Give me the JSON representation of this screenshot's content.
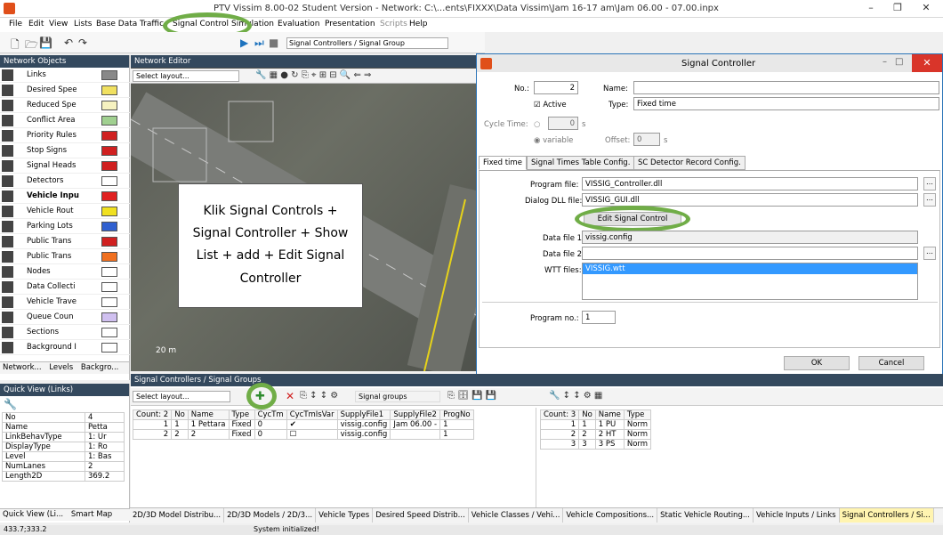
{
  "window": {
    "title": "PTV Vissim 8.00-02 Student Version - Network: C:\\...ents\\FIXXX\\Data Vissim\\Jam 16-17 am\\Jam 06.00 - 07.00.inpx",
    "controls": [
      "–",
      "❐",
      "✕"
    ]
  },
  "menu": [
    "File",
    "Edit",
    "View",
    "Lists",
    "Base Data",
    "Traffic",
    "Signal Control",
    "Simulation",
    "Evaluation",
    "Presentation",
    "Scripts",
    "Help"
  ],
  "toolbar": {
    "list_combo": "Signal Controllers / Signal Group"
  },
  "network_objects": {
    "title": "Network Objects",
    "items": [
      {
        "label": "Links",
        "icon": "link-icon"
      },
      {
        "label": "Desired Spee",
        "icon": "desired-speed-icon"
      },
      {
        "label": "Reduced Spe",
        "icon": "reduced-speed-icon"
      },
      {
        "label": "Conflict Area",
        "icon": "conflict-area-icon"
      },
      {
        "label": "Priority Rules",
        "icon": "priority-rule-icon"
      },
      {
        "label": "Stop Signs",
        "icon": "stop-sign-icon"
      },
      {
        "label": "Signal Heads",
        "icon": "signal-head-icon"
      },
      {
        "label": "Detectors",
        "icon": "detector-icon"
      },
      {
        "label": "Vehicle Inpu",
        "icon": "vehicle-input-icon"
      },
      {
        "label": "Vehicle Rout",
        "icon": "vehicle-route-icon"
      },
      {
        "label": "Parking Lots",
        "icon": "parking-icon"
      },
      {
        "label": "Public Trans",
        "icon": "public-transport-stop-icon"
      },
      {
        "label": "Public Trans",
        "icon": "public-transport-line-icon"
      },
      {
        "label": "Nodes",
        "icon": "node-icon"
      },
      {
        "label": "Data Collecti",
        "icon": "data-collection-icon"
      },
      {
        "label": "Vehicle Trave",
        "icon": "travel-time-icon"
      },
      {
        "label": "Queue Coun",
        "icon": "queue-counter-icon"
      },
      {
        "label": "Sections",
        "icon": "section-icon"
      },
      {
        "label": "Background I",
        "icon": "background-image-icon"
      }
    ],
    "tabs": [
      "Network...",
      "Levels",
      "Backgro..."
    ]
  },
  "network_editor": {
    "title": "Network Editor",
    "layout_combo": "Select layout...",
    "scale": "20 m"
  },
  "callout": {
    "text": "Klik Signal Controls + Signal Controller + Show List + add + Edit Signal Controller"
  },
  "quick_view": {
    "title": "Quick View (Links)",
    "rows": [
      [
        "No",
        "4"
      ],
      [
        "Name",
        "Petta"
      ],
      [
        "LinkBehavType",
        "1: Ur"
      ],
      [
        "DisplayType",
        "1: Ro"
      ],
      [
        "Level",
        "1: Bas"
      ],
      [
        "NumLanes",
        "2"
      ],
      [
        "Length2D",
        "369.2"
      ]
    ],
    "tabs": [
      "Quick View (Li...",
      "Smart Map"
    ]
  },
  "sc_list": {
    "title": "Signal Controllers / Signal Groups",
    "layout_combo": "Select layout...",
    "relation_combo": "Signal groups",
    "count_label": "Count: 2",
    "columns": [
      "No",
      "Name",
      "Type",
      "CycTm",
      "CycTmIsVar",
      "SupplyFile1",
      "SupplyFile2",
      "ProgNo"
    ],
    "rows": [
      [
        "1",
        "1 Pettara",
        "Fixed",
        "0",
        "✔",
        "vissig.config",
        "Jam 06.00 -",
        "1"
      ],
      [
        "2",
        "2",
        "Fixed",
        "0",
        "☐",
        "vissig.config",
        "",
        "1"
      ]
    ]
  },
  "sg_list": {
    "count_label": "Count: 3",
    "columns": [
      "No",
      "Name",
      "Type"
    ],
    "rows": [
      [
        "1",
        "1 PU",
        "Norm"
      ],
      [
        "2",
        "2 HT",
        "Norm"
      ],
      [
        "3",
        "3 PS",
        "Norm"
      ]
    ]
  },
  "dialog": {
    "title": "Signal Controller",
    "no_label": "No.:",
    "no_value": "2",
    "name_label": "Name:",
    "name_value": "",
    "active_label": "Active",
    "type_label": "Type:",
    "type_value": "Fixed time",
    "cycle_label": "Cycle Time:",
    "cycle_value": "0",
    "cycle_unit": "s",
    "variable_label": "variable",
    "offset_label": "Offset:",
    "offset_value": "0",
    "offset_unit": "s",
    "tabs": [
      "Fixed time",
      "Signal Times Table Config.",
      "SC Detector Record Config."
    ],
    "program_file_label": "Program file:",
    "program_file": "VISSIG_Controller.dll",
    "dialog_dll_label": "Dialog DLL file:",
    "dialog_dll": "VISSIG_GUI.dll",
    "edit_button": "Edit Signal Control",
    "data1_label": "Data file 1:",
    "data1": "vissig.config",
    "data2_label": "Data file 2:",
    "data2": "",
    "wtt_label": "WTT files:",
    "wtt": "VISSIG.wtt",
    "progno_label": "Program no.:",
    "progno": "1",
    "ok": "OK",
    "cancel": "Cancel"
  },
  "bottom_tabs": [
    "2D/3D Model Distribu...",
    "2D/3D Models / 2D/3...",
    "Vehicle Types",
    "Desired Speed Distrib...",
    "Vehicle Classes / Vehi...",
    "Vehicle Compositions...",
    "Static Vehicle Routing...",
    "Vehicle Inputs / Links",
    "Signal Controllers / Si..."
  ],
  "status": {
    "coords": "433.7;333.2",
    "message": "System initialized!"
  },
  "colors": {
    "highlight": "#70ad47",
    "header": "#34495e",
    "selection": "#3399ff"
  }
}
